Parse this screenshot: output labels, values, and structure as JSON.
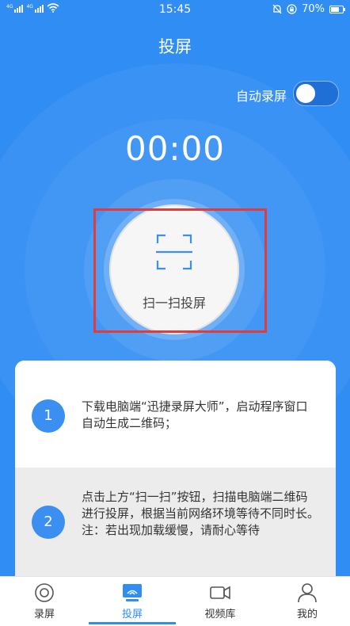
{
  "status_bar": {
    "signal_label_1": "4G",
    "signal_label_2": "4G",
    "time": "15:45",
    "battery": "70%"
  },
  "header": {
    "title": "投屏"
  },
  "auto_record": {
    "label": "自动录屏",
    "enabled": false
  },
  "timer": {
    "value": "00:00"
  },
  "scan_button": {
    "label": "扫一扫投屏",
    "icon": "scan-frame-icon"
  },
  "steps": [
    {
      "number": "1",
      "text": "下载电脑端“迅捷录屏大师”，启动程序窗口自动生成二维码；"
    },
    {
      "number": "2",
      "text": "点击上方“扫一扫”按钮，扫描电脑端二维码进行投屏，根据当前网络环境等待不同时长。注：若出现加载缓慢，请耐心等待"
    }
  ],
  "bottom_nav": [
    {
      "label": "录屏",
      "icon": "record-icon",
      "active": false
    },
    {
      "label": "投屏",
      "icon": "cast-screen-icon",
      "active": true
    },
    {
      "label": "视频库",
      "icon": "video-camera-icon",
      "active": false
    },
    {
      "label": "我的",
      "icon": "person-icon",
      "active": false
    }
  ],
  "colors": {
    "primary": "#2f8df4",
    "highlight_border": "#e43a3a",
    "card_step2_bg": "#ececec"
  }
}
